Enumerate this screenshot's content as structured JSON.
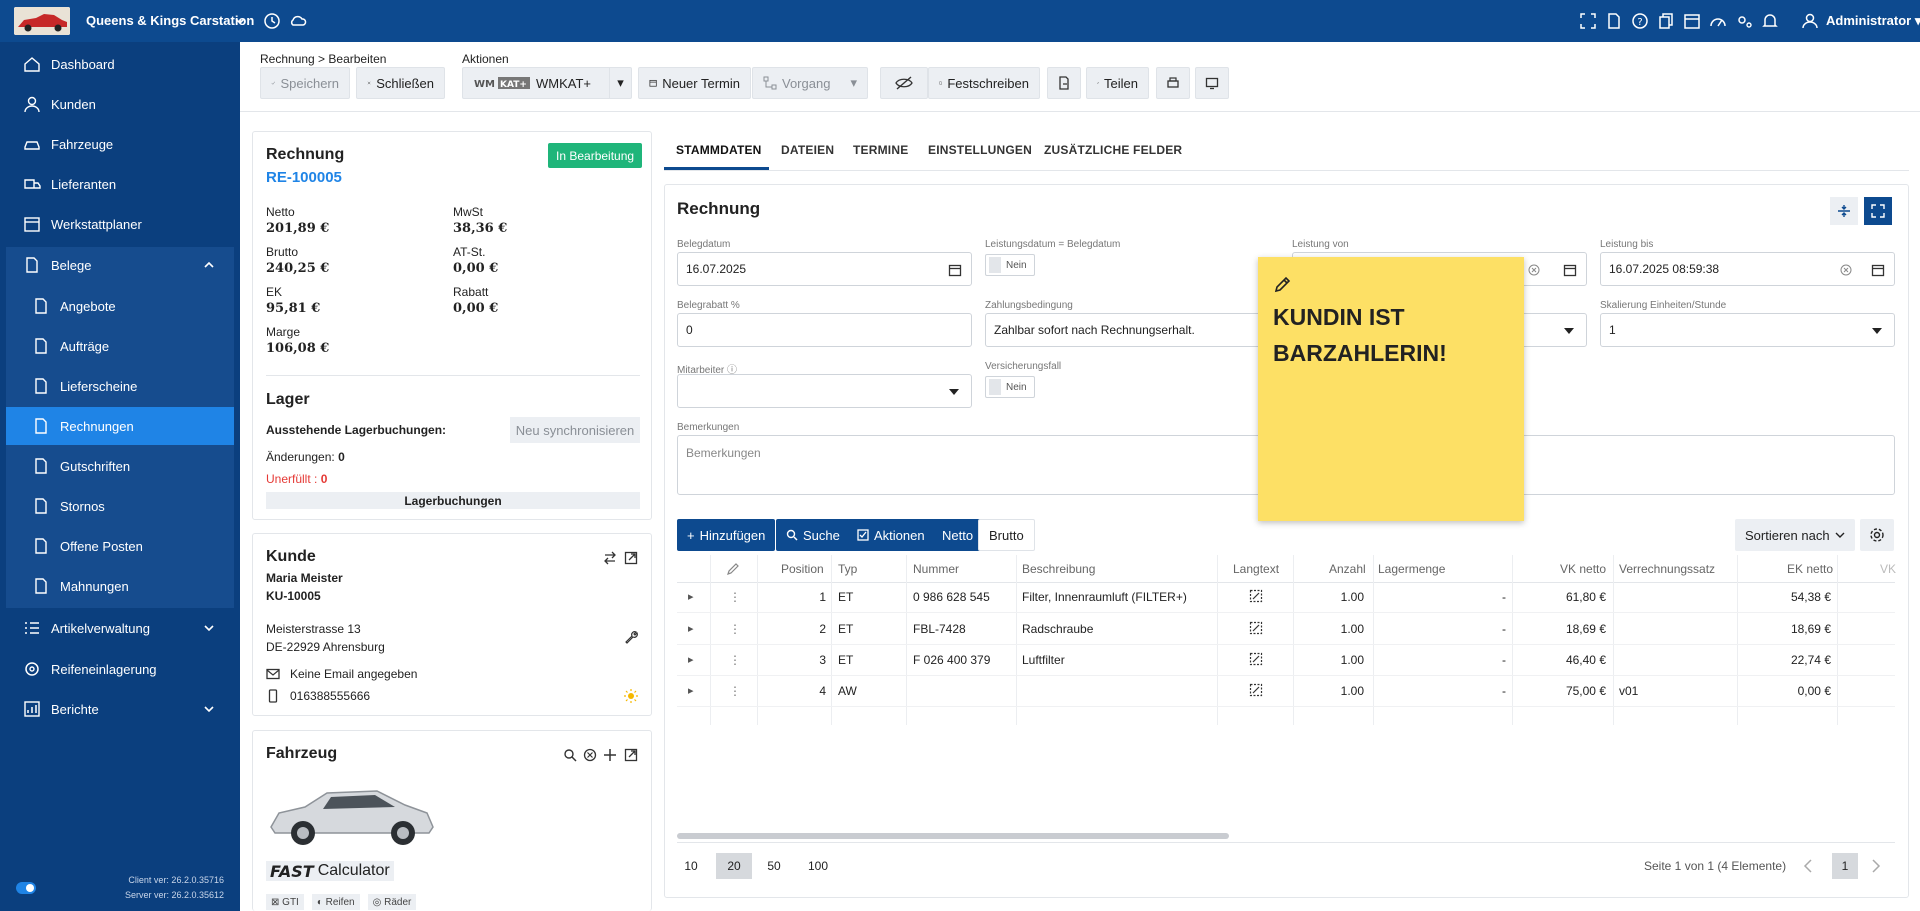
{
  "app": {
    "title": "Queens & Kings Carstation",
    "user": "Administrator"
  },
  "sidebar": {
    "items": [
      {
        "label": "Dashboard"
      },
      {
        "label": "Kunden"
      },
      {
        "label": "Fahrzeuge"
      },
      {
        "label": "Lieferanten"
      },
      {
        "label": "Werkstattplaner"
      },
      {
        "label": "Belege"
      },
      {
        "label": "Angebote"
      },
      {
        "label": "Aufträge"
      },
      {
        "label": "Lieferscheine"
      },
      {
        "label": "Rechnungen"
      },
      {
        "label": "Gutschriften"
      },
      {
        "label": "Stornos"
      },
      {
        "label": "Offene Posten"
      },
      {
        "label": "Mahnungen"
      },
      {
        "label": "Artikelverwaltung"
      },
      {
        "label": "Reifeneinlagerung"
      },
      {
        "label": "Berichte"
      }
    ],
    "client_ver": "Client ver: 26.2.0.35716",
    "server_ver": "Server ver: 26.2.0.35612"
  },
  "toolbar": {
    "breadcrumb": "Rechnung > Bearbeiten",
    "actions_label": "Aktionen",
    "save": "Speichern",
    "close": "Schließen",
    "wmkat": "WMKAT+",
    "new_appt": "Neuer Termin",
    "process": "Vorgang",
    "finalize": "Festschreiben",
    "share": "Teilen"
  },
  "invoice_card": {
    "title": "Rechnung",
    "status": "In Bearbeitung",
    "number": "RE-100005",
    "netto_label": "Netto",
    "netto": "201,89 €",
    "mwst_label": "MwSt",
    "mwst": "38,36 €",
    "brutto_label": "Brutto",
    "brutto": "240,25 €",
    "atst_label": "AT-St.",
    "atst": "0,00 €",
    "ek_label": "EK",
    "ek": "95,81 €",
    "rabatt_label": "Rabatt",
    "rabatt": "0,00 €",
    "marge_label": "Marge",
    "marge": "106,08 €",
    "lager_title": "Lager",
    "pending_label": "Ausstehende Lagerbuchungen:",
    "sync_btn": "Neu synchronisieren",
    "changes_label": "Änderungen:",
    "changes_val": "0",
    "unfilled_label": "Unerfüllt :",
    "unfilled_val": "0",
    "lager_btn": "Lagerbuchungen"
  },
  "customer_card": {
    "title": "Kunde",
    "name": "Maria Meister",
    "id": "KU-10005",
    "street": "Meisterstrasse 13",
    "city": "DE-22929 Ahrensburg",
    "email": "Keine Email angegeben",
    "phone": "016388555666"
  },
  "vehicle_card": {
    "title": "Fahrzeug",
    "fast_calc": "Calculator",
    "fast_prefix": "FAST",
    "chips": [
      "GTI",
      "Reifen",
      "Räder"
    ]
  },
  "tabs": [
    "STAMMDATEN",
    "DATEIEN",
    "TERMINE",
    "EINSTELLUNGEN",
    "ZUSÄTZLICHE FELDER"
  ],
  "form": {
    "title": "Rechnung",
    "belegdatum_label": "Belegdatum",
    "belegdatum": "16.07.2025",
    "leistungsdatum_label": "Leistungsdatum = Belegdatum",
    "leistungsdatum_val": "Nein",
    "leistung_von_label": "Leistung von",
    "leistung_bis_label": "Leistung bis",
    "leistung_bis": "16.07.2025 08:59:38",
    "belegrabatt_label": "Belegrabatt %",
    "belegrabatt": "0",
    "zahlung_label": "Zahlungsbedingung",
    "zahlung": "Zahlbar sofort nach Rechnungserhalt.",
    "skalierung_label": "Skalierung Einheiten/Stunde",
    "skalierung": "1",
    "mitarbeiter_label": "Mitarbeiter",
    "versicherung_label": "Versicherungsfall",
    "versicherung_val": "Nein",
    "bemerkungen_label": "Bemerkungen",
    "bemerkungen_placeholder": "Bemerkungen"
  },
  "table_actions": {
    "add": "Hinzufügen",
    "search": "Suche",
    "actions": "Aktionen",
    "netto": "Netto",
    "brutto": "Brutto",
    "sort": "Sortieren nach"
  },
  "table": {
    "columns": [
      "Position",
      "Typ",
      "Nummer",
      "Beschreibung",
      "Langtext",
      "Anzahl",
      "Lagermenge",
      "VK netto",
      "Verrechnungssatz",
      "EK netto",
      "VK"
    ],
    "rows": [
      {
        "pos": "1",
        "typ": "ET",
        "nummer": "0 986 628 545",
        "beschreibung": "Filter, Innenraumluft (FILTER+)",
        "anzahl": "1.00",
        "lager": "-",
        "vk": "61,80 €",
        "satz": "",
        "ek": "54,38 €"
      },
      {
        "pos": "2",
        "typ": "ET",
        "nummer": "FBL-7428",
        "beschreibung": "Radschraube",
        "anzahl": "1.00",
        "lager": "-",
        "vk": "18,69 €",
        "satz": "",
        "ek": "18,69 €"
      },
      {
        "pos": "3",
        "typ": "ET",
        "nummer": "F 026 400 379",
        "beschreibung": "Luftfilter",
        "anzahl": "1.00",
        "lager": "-",
        "vk": "46,40 €",
        "satz": "",
        "ek": "22,74 €"
      },
      {
        "pos": "4",
        "typ": "AW",
        "nummer": "",
        "beschreibung": "",
        "anzahl": "1.00",
        "lager": "-",
        "vk": "75,00 €",
        "satz": "v01",
        "ek": "0,00 €"
      }
    ]
  },
  "pagination": {
    "sizes": [
      "10",
      "20",
      "50",
      "100"
    ],
    "info": "Seite 1 von 1 (4 Elemente)",
    "page": "1"
  },
  "sticky_note": {
    "text": "KUNDIN IST BARZAHLERIN!"
  },
  "colors": {
    "primary": "#0d4a8f",
    "sidebar": "#0b3f7e",
    "active": "#1f84e6",
    "status": "#1fb57a",
    "note": "#fde065"
  }
}
